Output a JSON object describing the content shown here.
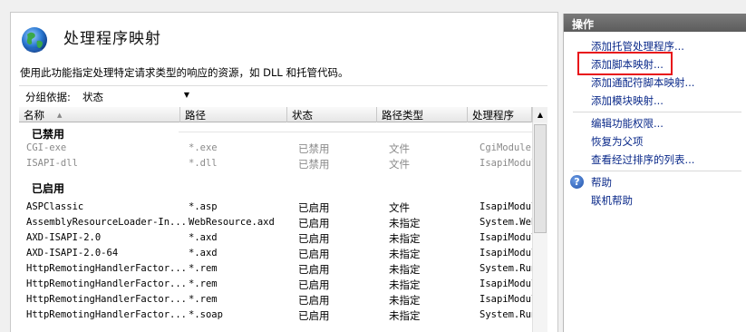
{
  "main": {
    "title": "处理程序映射",
    "description": "使用此功能指定处理特定请求类型的响应的资源，如 DLL 和托管代码。",
    "group_by_label": "分组依据:",
    "group_by_value": "状态",
    "columns": [
      "名称",
      "路径",
      "状态",
      "路径类型",
      "处理程序"
    ],
    "groups": [
      {
        "name": "已禁用",
        "rows": [
          [
            "CGI-exe",
            "*.exe",
            "已禁用",
            "文件",
            "CgiModule"
          ],
          [
            "ISAPI-dll",
            "*.dll",
            "已禁用",
            "文件",
            "IsapiModul"
          ]
        ]
      },
      {
        "name": "已启用",
        "rows": [
          [
            "ASPClassic",
            "*.asp",
            "已启用",
            "文件",
            "IsapiModul"
          ],
          [
            "AssemblyResourceLoader-In...",
            "WebResource.axd",
            "已启用",
            "未指定",
            "System.Web"
          ],
          [
            "AXD-ISAPI-2.0",
            "*.axd",
            "已启用",
            "未指定",
            "IsapiModul"
          ],
          [
            "AXD-ISAPI-2.0-64",
            "*.axd",
            "已启用",
            "未指定",
            "IsapiModul"
          ],
          [
            "HttpRemotingHandlerFactor...",
            "*.rem",
            "已启用",
            "未指定",
            "System.Run"
          ],
          [
            "HttpRemotingHandlerFactor...",
            "*.rem",
            "已启用",
            "未指定",
            "IsapiModul"
          ],
          [
            "HttpRemotingHandlerFactor...",
            "*.rem",
            "已启用",
            "未指定",
            "IsapiModul"
          ],
          [
            "HttpRemotingHandlerFactor...",
            "*.soap",
            "已启用",
            "未指定",
            "System.Run"
          ]
        ]
      }
    ]
  },
  "actions": {
    "header": "操作",
    "links": [
      "添加托管处理程序...",
      "添加脚本映射...",
      "添加通配符脚本映射...",
      "添加模块映射..."
    ],
    "links2": [
      "编辑功能权限...",
      "恢复为父项",
      "查看经过排序的列表..."
    ],
    "help": "帮助",
    "online_help": "联机帮助",
    "highlight_color": "#e8141a"
  }
}
